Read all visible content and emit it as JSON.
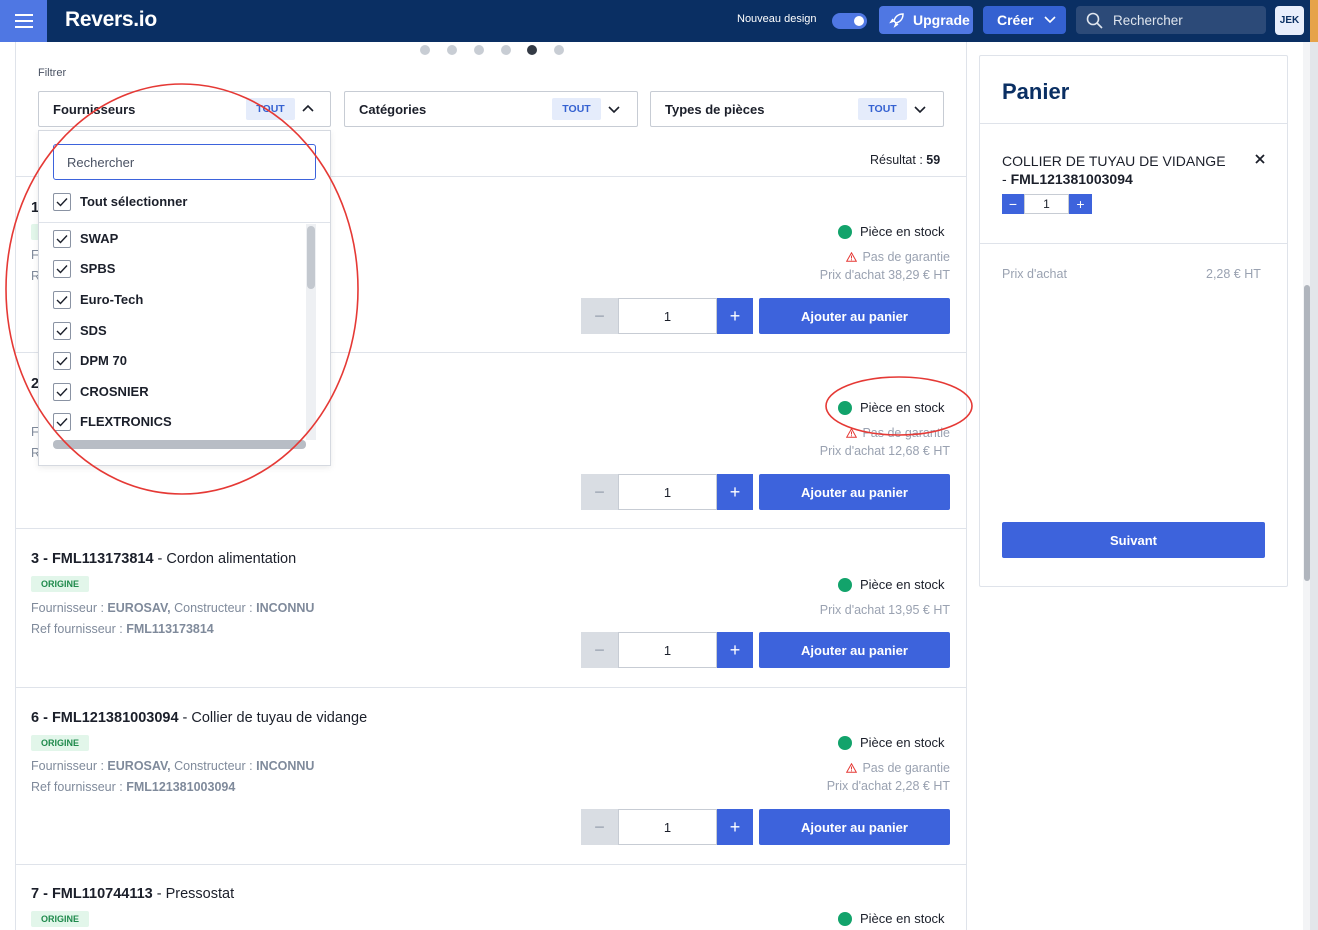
{
  "topbar": {
    "logo": "Revers.io",
    "new_design_label": "Nouveau design",
    "upgrade_label": "Upgrade",
    "create_label": "Créer",
    "search_placeholder": "Rechercher",
    "avatar_initials": "JEK"
  },
  "carousel": {
    "count": 6,
    "active_index": 4
  },
  "filters": {
    "label": "Filtrer",
    "suppliers": {
      "label": "Fournisseurs",
      "badge": "TOUT"
    },
    "categories": {
      "label": "Catégories",
      "badge": "TOUT"
    },
    "part_types": {
      "label": "Types de pièces",
      "badge": "TOUT"
    }
  },
  "results": {
    "label": "Résultat :",
    "count": "59"
  },
  "dropdown": {
    "search_placeholder": "Rechercher",
    "select_all": "Tout sélectionner",
    "options": [
      "SWAP",
      "SPBS",
      "Euro-Tech",
      "SDS",
      "DPM 70",
      "CROSNIER",
      "FLEXTRONICS"
    ]
  },
  "items": [
    {
      "title_num": "1",
      "stock": "Pièce en stock",
      "warranty": "Pas de garantie",
      "price": "Prix d'achat 38,29 € HT",
      "qty": "1",
      "add_label": "Ajouter au panier",
      "meta_l1": "F",
      "meta_l2": "R"
    },
    {
      "title_num": "2",
      "stock": "Pièce en stock",
      "warranty": "Pas de garantie",
      "price": "Prix d'achat 12,68 € HT",
      "qty": "1",
      "add_label": "Ajouter au panier",
      "meta_l1": "F",
      "meta_l2": "R"
    },
    {
      "code": "3 - FML113173814",
      "name": " - Cordon alimentation",
      "tag": "ORIGINE",
      "supplier_label": "Fournisseur : ",
      "supplier": "EUROSAV,",
      "maker_label": " Constructeur : ",
      "maker": "INCONNU",
      "ref_label": "Ref fournisseur : ",
      "ref": "FML113173814",
      "stock": "Pièce en stock",
      "price": "Prix d'achat 13,95 € HT",
      "qty": "1",
      "add_label": "Ajouter au panier"
    },
    {
      "code": "6 - FML121381003094",
      "name": " - Collier de tuyau de vidange",
      "tag": "ORIGINE",
      "supplier_label": "Fournisseur : ",
      "supplier": "EUROSAV,",
      "maker_label": " Constructeur : ",
      "maker": "INCONNU",
      "ref_label": "Ref fournisseur : ",
      "ref": "FML121381003094",
      "stock": "Pièce en stock",
      "warranty": "Pas de garantie",
      "price": "Prix d'achat 2,28 € HT",
      "qty": "1",
      "add_label": "Ajouter au panier"
    },
    {
      "code": "7 - FML110744113",
      "name": " - Pressostat",
      "tag": "ORIGINE",
      "stock": "Pièce en stock"
    }
  ],
  "cart": {
    "title": "Panier",
    "item_name": "COLLIER DE TUYAU DE VIDANGE - ",
    "item_code": "FML121381003094",
    "qty": "1",
    "price_label": "Prix d'achat",
    "price_value": "2,28 € HT",
    "next_label": "Suivant"
  },
  "colors": {
    "navy": "#0a2f63",
    "accent": "#3d63dc",
    "stock_green": "#12a36b",
    "annotation_red": "#e53935"
  }
}
